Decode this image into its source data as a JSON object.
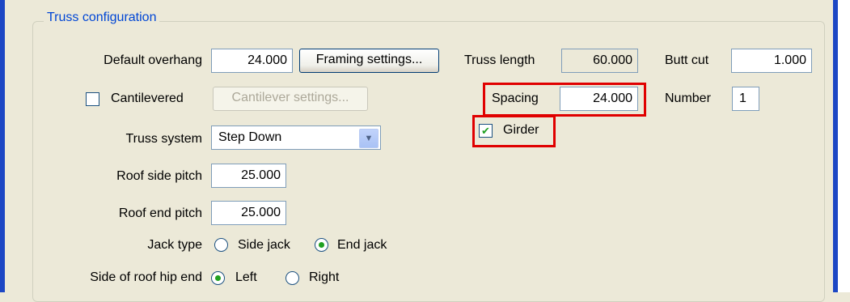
{
  "group": {
    "title": "Truss configuration"
  },
  "overhang": {
    "label": "Default overhang",
    "value": "24.000",
    "button": "Framing settings..."
  },
  "cantilever": {
    "label": "Cantilevered",
    "checked": false,
    "button": "Cantilever settings..."
  },
  "truss_system": {
    "label": "Truss system",
    "value": "Step Down"
  },
  "roof_side_pitch": {
    "label": "Roof side pitch",
    "value": "25.000"
  },
  "roof_end_pitch": {
    "label": "Roof end pitch",
    "value": "25.000"
  },
  "jack_type": {
    "label": "Jack type",
    "options": [
      "Side jack",
      "End jack"
    ],
    "selected": "End jack"
  },
  "hip_end": {
    "label": "Side of roof hip end",
    "options": [
      "Left",
      "Right"
    ],
    "selected": "Left"
  },
  "truss_length": {
    "label": "Truss length",
    "value": "60.000"
  },
  "spacing": {
    "label": "Spacing",
    "value": "24.000"
  },
  "girder": {
    "label": "Girder",
    "checked": true
  },
  "butt_cut": {
    "label": "Butt cut",
    "value": "1.000"
  },
  "number": {
    "label": "Number",
    "value": "1"
  },
  "colors": {
    "highlight": "#e00000",
    "groupbox_title": "#0046d5",
    "window_frame": "#1c47c4",
    "check_mark": "#21a121"
  },
  "icons": {
    "check": "check-mark-icon",
    "dropdown": "chevron-down-icon"
  }
}
